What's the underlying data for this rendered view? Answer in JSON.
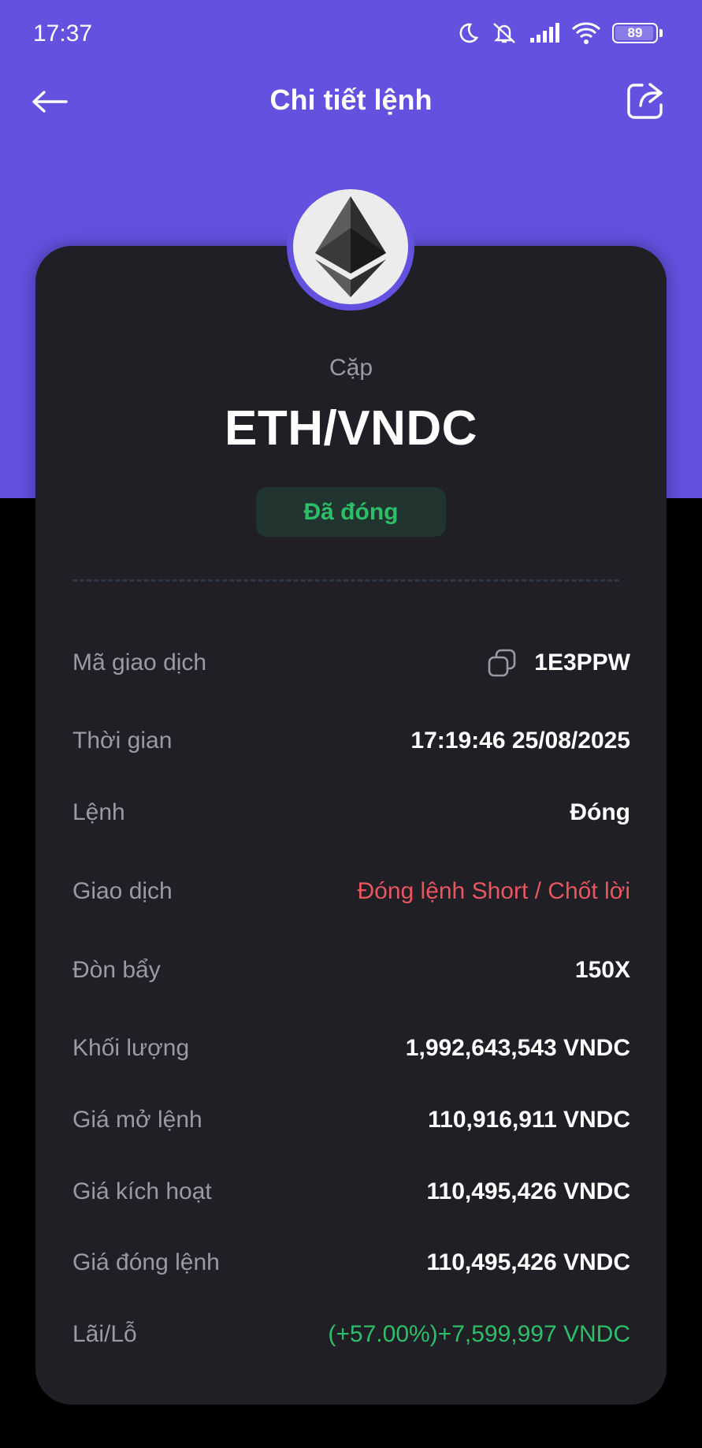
{
  "status_bar": {
    "time": "17:37",
    "battery": "89"
  },
  "nav": {
    "title": "Chi tiết lệnh"
  },
  "coin": {
    "icon": "ethereum-icon"
  },
  "pair": {
    "label": "Cặp",
    "value": "ETH/VNDC"
  },
  "status": {
    "label": "Đã đóng",
    "color": "#2DBF68"
  },
  "details": [
    {
      "label": "Mã giao dịch",
      "value": "1E3PPW"
    },
    {
      "label": "Thời gian",
      "value": "17:19:46 25/08/2025"
    },
    {
      "label": "Lệnh",
      "value": "Đóng"
    },
    {
      "label": "Giao dịch",
      "value": "Đóng lệnh Short / Chốt lời"
    },
    {
      "label": "Đòn bẩy",
      "value": "150X"
    },
    {
      "label": "Khối lượng",
      "value": "1,992,643,543 VNDC"
    },
    {
      "label": "Giá mở lệnh",
      "value": "110,916,911 VNDC"
    },
    {
      "label": "Giá kích hoạt",
      "value": "110,495,426 VNDC"
    },
    {
      "label": "Giá đóng lệnh",
      "value": "110,495,426 VNDC"
    },
    {
      "label": "Lãi/Lỗ",
      "value": "(+57.00%)+7,599,997 VNDC"
    }
  ],
  "colors": {
    "brand": "#6351E0",
    "card": "#1F1F25",
    "negative": "#E8565F",
    "positive": "#2DBF68"
  }
}
